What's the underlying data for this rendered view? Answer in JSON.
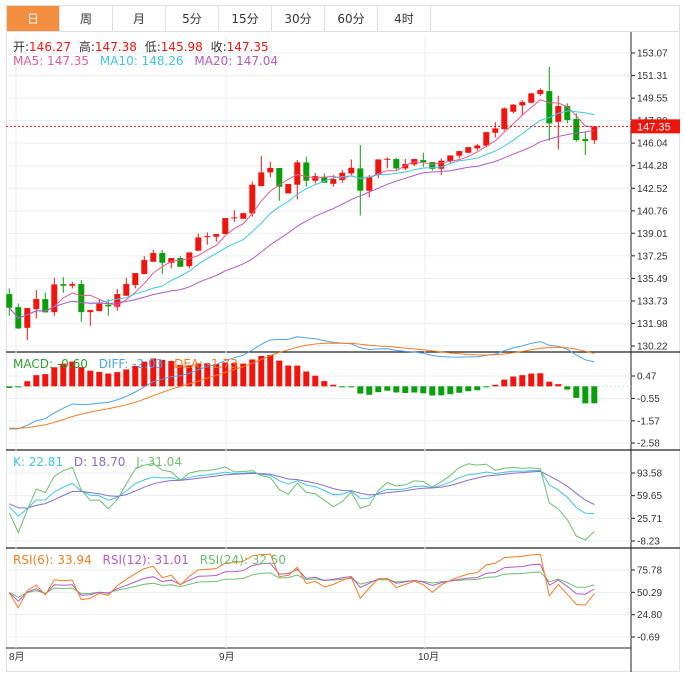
{
  "tabs": [
    "日",
    "周",
    "月",
    "5分",
    "15分",
    "30分",
    "60分",
    "4时"
  ],
  "active_tab": 0,
  "header": {
    "open_label": "开:",
    "open": "146.27",
    "high_label": "高:",
    "high": "147.38",
    "low_label": "低:",
    "low": "145.98",
    "close_label": "收:",
    "close": "147.35",
    "ma5": "MA5: 147.35",
    "ma10": "MA10: 148.26",
    "ma20": "MA20: 147.04"
  },
  "macd_legend": {
    "macd": "MACD: -0.60",
    "diff": "DIFF: -2.03",
    "dea": "DEA: -1.73"
  },
  "kdj_legend": {
    "k": "K: 22.81",
    "d": "D: 18.70",
    "j": "J: 31.04"
  },
  "rsi_legend": {
    "rsi6": "RSI(6): 33.94",
    "rsi12": "RSI(12): 31.01",
    "rsi24": "RSI(24): 32.50"
  },
  "colors": {
    "up": "#f0140c",
    "down": "#0a9f0a",
    "ma5": "#ec5a8c",
    "ma10": "#3ec7df",
    "ma20": "#b25ac8",
    "diff": "#4aa3ef",
    "dea": "#f57c20",
    "k": "#3ec7df",
    "d": "#8a6bd0",
    "j": "#6cbf6c",
    "rsi6": "#f57c20",
    "rsi12": "#b25ac8",
    "rsi24": "#6cbf6c"
  },
  "chart_data": {
    "type": "candlestick",
    "x_tick_labels": [
      "8月",
      "9月",
      "10月"
    ],
    "price_ticks": [
      "153.07",
      "151.31",
      "149.55",
      "147.80",
      "146.04",
      "144.28",
      "142.52",
      "140.76",
      "139.01",
      "137.25",
      "135.49",
      "133.73",
      "131.98",
      "130.22"
    ],
    "price_range": [
      130.22,
      153.07
    ],
    "last_price": "147.35",
    "macd_ticks": [
      "0.47",
      "-0.55",
      "-1.57",
      "-2.58"
    ],
    "kdj_ticks": [
      "93.58",
      "59.65",
      "25.71",
      "-8.23"
    ],
    "rsi_ticks": [
      "75.78",
      "50.29",
      "24.80",
      "-0.69"
    ],
    "ohlc": [
      [
        134.27,
        134.71,
        132.58,
        133.2
      ],
      [
        133.25,
        133.54,
        131.55,
        131.59
      ],
      [
        131.64,
        133.18,
        130.68,
        133.18
      ],
      [
        133.1,
        134.58,
        132.37,
        133.88
      ],
      [
        133.88,
        134.4,
        132.84,
        132.84
      ],
      [
        132.86,
        135.54,
        132.58,
        135.02
      ],
      [
        135.05,
        135.59,
        134.37,
        134.92
      ],
      [
        134.92,
        135.23,
        134.71,
        135.05
      ],
      [
        135.05,
        135.36,
        132.11,
        132.86
      ],
      [
        132.86,
        133.02,
        131.8,
        133.02
      ],
      [
        132.94,
        133.85,
        132.94,
        133.51
      ],
      [
        133.44,
        133.85,
        132.58,
        133.31
      ],
      [
        133.28,
        134.66,
        132.97,
        134.27
      ],
      [
        134.14,
        135.54,
        134.14,
        135.05
      ],
      [
        134.97,
        135.91,
        134.71,
        135.91
      ],
      [
        135.83,
        137.23,
        135.83,
        136.92
      ],
      [
        136.79,
        137.7,
        136.79,
        137.47
      ],
      [
        137.47,
        137.7,
        135.83,
        136.71
      ],
      [
        136.71,
        137.08,
        136.27,
        137.08
      ],
      [
        137.08,
        137.23,
        136.4,
        136.4
      ],
      [
        136.45,
        137.52,
        136.27,
        137.52
      ],
      [
        137.65,
        138.99,
        137.65,
        138.69
      ],
      [
        138.71,
        139.08,
        138.12,
        138.79
      ],
      [
        138.74,
        138.95,
        138.35,
        138.95
      ],
      [
        138.95,
        140.2,
        138.95,
        140.2
      ],
      [
        140.17,
        140.82,
        139.91,
        140.25
      ],
      [
        140.14,
        140.58,
        140.14,
        140.58
      ],
      [
        140.56,
        143.06,
        140.3,
        142.8
      ],
      [
        142.69,
        145.03,
        142.69,
        143.76
      ],
      [
        143.76,
        144.59,
        143.37,
        144.1
      ],
      [
        144.1,
        144.1,
        141.55,
        142.64
      ],
      [
        142.12,
        142.85,
        142.12,
        142.85
      ],
      [
        142.8,
        144.72,
        141.65,
        144.54
      ],
      [
        144.54,
        144.98,
        142.64,
        143.11
      ],
      [
        143.11,
        143.72,
        142.9,
        143.47
      ],
      [
        143.42,
        143.68,
        142.95,
        142.95
      ],
      [
        142.87,
        143.55,
        142.64,
        143.24
      ],
      [
        143.16,
        143.94,
        142.95,
        143.73
      ],
      [
        143.68,
        144.77,
        143.55,
        144.12
      ],
      [
        144.07,
        145.89,
        140.4,
        142.33
      ],
      [
        142.33,
        143.55,
        141.81,
        143.42
      ],
      [
        143.6,
        144.77,
        143.29,
        144.77
      ],
      [
        144.75,
        144.93,
        144.07,
        144.82
      ],
      [
        144.8,
        144.88,
        143.94,
        144.07
      ],
      [
        144.07,
        144.8,
        143.94,
        144.41
      ],
      [
        144.38,
        144.8,
        144.25,
        144.8
      ],
      [
        144.72,
        145.29,
        144.2,
        144.56
      ],
      [
        144.56,
        144.56,
        143.89,
        144.04
      ],
      [
        144.04,
        144.85,
        143.55,
        144.67
      ],
      [
        144.64,
        145.08,
        144.46,
        145.08
      ],
      [
        145.06,
        145.42,
        144.85,
        145.42
      ],
      [
        145.29,
        145.73,
        145.24,
        145.73
      ],
      [
        145.63,
        145.97,
        145.45,
        145.86
      ],
      [
        145.84,
        146.9,
        145.71,
        146.9
      ],
      [
        146.85,
        147.68,
        146.49,
        147.19
      ],
      [
        147.14,
        148.83,
        147.01,
        148.75
      ],
      [
        148.49,
        149.09,
        148.36,
        149.04
      ],
      [
        148.98,
        149.4,
        148.23,
        149.24
      ],
      [
        149.19,
        149.97,
        149.14,
        149.92
      ],
      [
        149.87,
        150.31,
        149.71,
        150.18
      ],
      [
        150.1,
        152.0,
        146.23,
        147.58
      ],
      [
        147.71,
        149.74,
        145.55,
        148.93
      ],
      [
        148.93,
        149.14,
        147.58,
        147.84
      ],
      [
        147.92,
        148.36,
        146.15,
        146.28
      ],
      [
        146.36,
        146.93,
        145.11,
        146.2
      ],
      [
        146.27,
        147.38,
        145.98,
        147.35
      ]
    ]
  }
}
